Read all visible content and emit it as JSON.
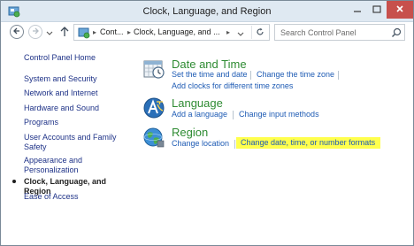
{
  "window": {
    "title": "Clock, Language, and Region"
  },
  "address": {
    "crumbs": [
      "Cont...",
      "Clock, Language, and ..."
    ],
    "search_placeholder": "Search Control Panel"
  },
  "sidebar": {
    "items": [
      {
        "label": "Control Panel Home"
      },
      {
        "label": "System and Security"
      },
      {
        "label": "Network and Internet"
      },
      {
        "label": "Hardware and Sound"
      },
      {
        "label": "Programs"
      },
      {
        "label": "User Accounts and Family Safety"
      },
      {
        "label": "Appearance and Personalization"
      },
      {
        "label": "Clock, Language, and Region",
        "current": true
      },
      {
        "label": "Ease of Access"
      }
    ]
  },
  "categories": [
    {
      "title": "Date and Time",
      "icon": "clock-calendar-icon",
      "tasks": [
        "Set the time and date",
        "Change the time zone",
        "Add clocks for different time zones"
      ]
    },
    {
      "title": "Language",
      "icon": "language-icon",
      "tasks": [
        "Add a language",
        "Change input methods"
      ]
    },
    {
      "title": "Region",
      "icon": "globe-icon",
      "tasks": [
        "Change location",
        "Change date, time, or number formats"
      ],
      "highlighted_task": 1
    }
  ],
  "colors": {
    "link": "#1e5bb4",
    "category_title": "#2e8b32",
    "sidebar_link": "#1e3287",
    "highlight": "#ffff4d",
    "close_button": "#c7504c"
  }
}
